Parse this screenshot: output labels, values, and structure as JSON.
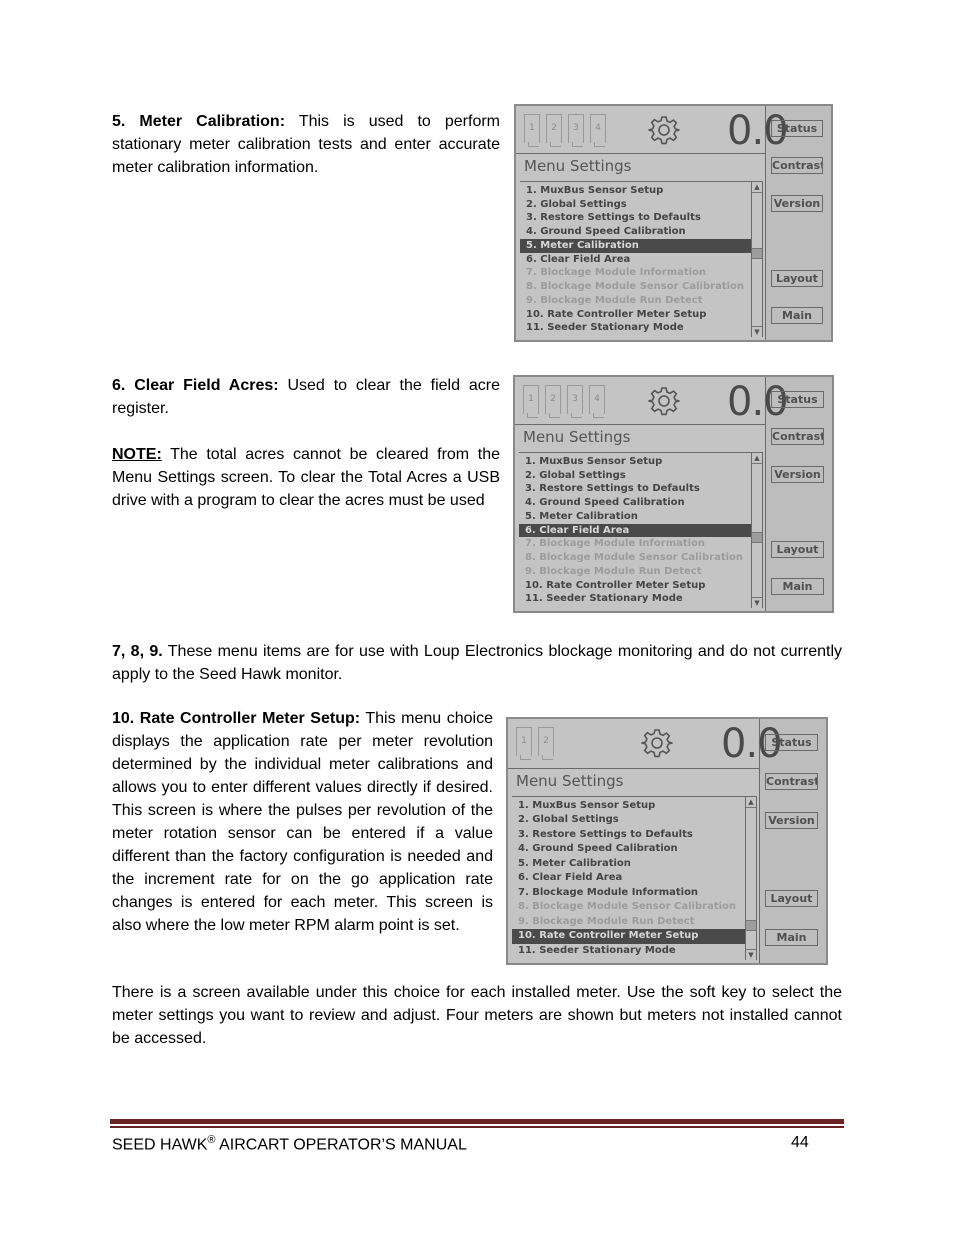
{
  "sections": {
    "meter_calibration": {
      "heading": "5. Meter Calibration:",
      "body": "This is used to perform stationary meter calibration tests and enter accurate meter calibration information."
    },
    "clear_field_acres": {
      "heading": "6. Clear Field Acres:",
      "body": "Used to clear the field acre register.",
      "note_label": "NOTE:",
      "note_body": "The total acres cannot be cleared from the Menu Settings screen. To clear the Total Acres a USB drive with a program to clear the acres must be used"
    },
    "items_789": {
      "heading": "7, 8, 9.",
      "body": "These menu items are for use with Loup Electronics blockage monitoring and do not currently apply to the Seed Hawk monitor."
    },
    "rate_controller": {
      "heading": "10. Rate Controller Meter Setup:",
      "body": "This menu choice displays the application rate per meter revolution determined by the individual meter calibrations and allows you to enter different values directly if desired. This screen is where the pulses per revolution of the meter rotation sensor can be entered if a value different than the factory configuration is needed and the increment rate for on the go application rate changes is entered for each meter. This screen is also where the low meter RPM alarm point is set."
    },
    "meter_screens": {
      "body": "There is a screen available under this choice for each installed meter. Use the soft key to select the meter settings you want to review and adjust. Four meters are shown but meters not installed cannot be accessed."
    }
  },
  "screens": [
    {
      "meter_tabs": [
        "1",
        "2",
        "3",
        "4"
      ],
      "big_value": "0.0",
      "title": "Menu Settings",
      "selected_index": 4,
      "disabled_indices": [
        6,
        7,
        8
      ],
      "scroll_position": 0.45,
      "items": [
        "1. MuxBus Sensor Setup",
        "2. Global Settings",
        "3. Restore Settings to Defaults",
        "4. Ground Speed Calibration",
        "5. Meter Calibration",
        "6. Clear Field Area",
        "7. Blockage Module Information",
        "8. Blockage Module Sensor Calibration",
        "9. Blockage Module Run Detect",
        "10. Rate Controller Meter Setup",
        "11. Seeder Stationary Mode"
      ],
      "softkeys": [
        "Status",
        "Contrast",
        "Version",
        "Layout",
        "Main"
      ]
    },
    {
      "meter_tabs": [
        "1",
        "2",
        "3",
        "4"
      ],
      "big_value": "0.0",
      "title": "Menu Settings",
      "selected_index": 5,
      "disabled_indices": [
        6,
        7,
        8
      ],
      "scroll_position": 0.55,
      "items": [
        "1. MuxBus Sensor Setup",
        "2. Global Settings",
        "3. Restore Settings to Defaults",
        "4. Ground Speed Calibration",
        "5. Meter Calibration",
        "6. Clear Field Area",
        "7. Blockage Module Information",
        "8. Blockage Module Sensor Calibration",
        "9. Blockage Module Run Detect",
        "10. Rate Controller Meter Setup",
        "11. Seeder Stationary Mode"
      ],
      "softkeys": [
        "Status",
        "Contrast",
        "Version",
        "Layout",
        "Main"
      ]
    },
    {
      "meter_tabs": [
        "1",
        "2"
      ],
      "big_value": "0.0",
      "title": "Menu Settings",
      "selected_index": 9,
      "disabled_indices": [
        7,
        8
      ],
      "scroll_position": 0.85,
      "items": [
        "1. MuxBus Sensor Setup",
        "2. Global Settings",
        "3. Restore Settings to Defaults",
        "4. Ground Speed Calibration",
        "5. Meter Calibration",
        "6. Clear Field Area",
        "7. Blockage Module Information",
        "8. Blockage Module Sensor Calibration",
        "9. Blockage Module Run Detect",
        "10. Rate Controller Meter Setup",
        "11. Seeder Stationary Mode"
      ],
      "softkeys": [
        "Status",
        "Contrast",
        "Version",
        "Layout",
        "Main"
      ]
    }
  ],
  "footer": {
    "title": "SEED HAWK",
    "registered": "®",
    "subtitle": " AIRCART OPERATOR’S MANUAL",
    "page_number": "44",
    "rule_color": "#6b2426"
  }
}
